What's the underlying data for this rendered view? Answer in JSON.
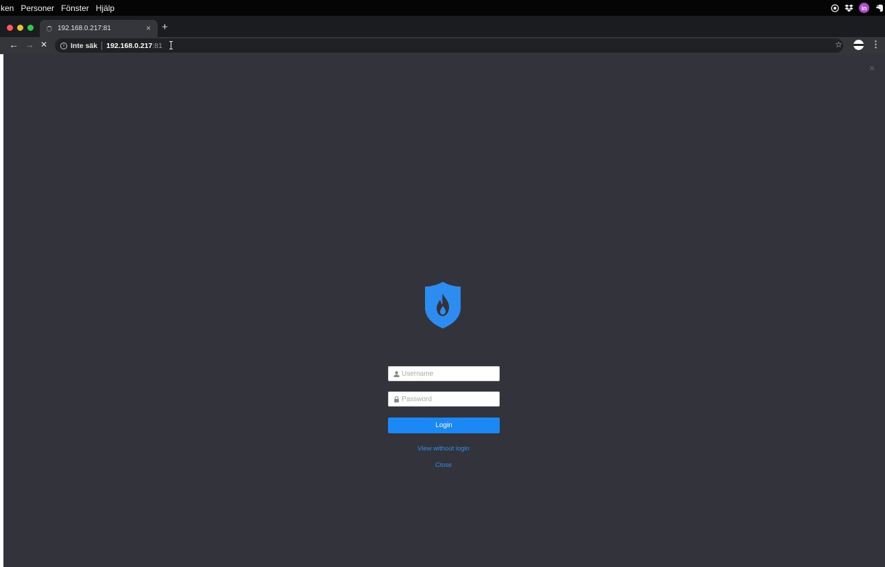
{
  "menubar": {
    "items": [
      "ken",
      "Personer",
      "Fönster",
      "Hjälp"
    ]
  },
  "tab": {
    "title": "192.168.0.217:81",
    "close_glyph": "×",
    "new_tab_glyph": "+"
  },
  "toolbar": {
    "back_glyph": "←",
    "forward_glyph": "→",
    "stop_glyph": "✕",
    "security_label": "Inte säk",
    "host": "192.168.0.217",
    "port": ":81"
  },
  "login": {
    "username_placeholder": "Username",
    "password_placeholder": "Password",
    "login_label": "Login",
    "view_without_login_label": "View without login",
    "close_label": "Close"
  },
  "colors": {
    "page_background": "#33333c",
    "accent": "#1a88f5",
    "link": "#2e8ff0"
  },
  "icons": [
    "shield-flame-logo-icon",
    "user-icon",
    "lock-icon",
    "star-icon",
    "info-icon",
    "close-icon"
  ]
}
